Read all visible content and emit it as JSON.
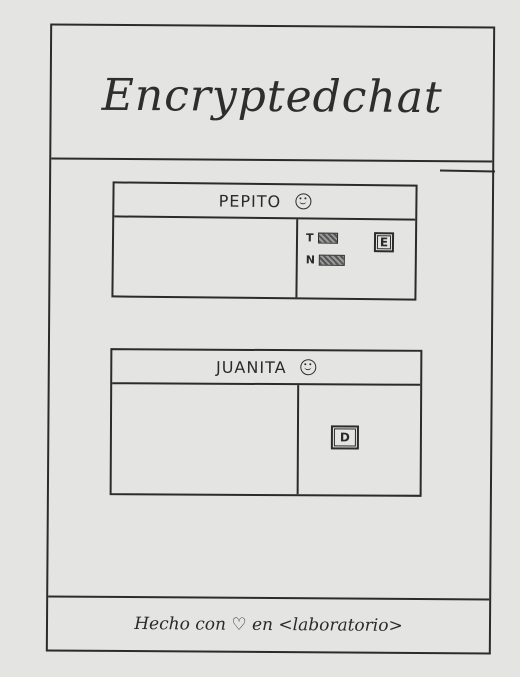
{
  "app": {
    "title": "Encryptedchat"
  },
  "panels": [
    {
      "name": "PEPITO",
      "mood_icon": "smiley-icon",
      "controls": {
        "fields": [
          {
            "label": "T"
          },
          {
            "label": "N"
          }
        ],
        "button": {
          "label": "E"
        }
      }
    },
    {
      "name": "JUANITA",
      "mood_icon": "smiley-icon",
      "controls": {
        "button": {
          "label": "D"
        }
      }
    }
  ],
  "footer": {
    "text": "Hecho con ♡ en <laboratorio>"
  }
}
